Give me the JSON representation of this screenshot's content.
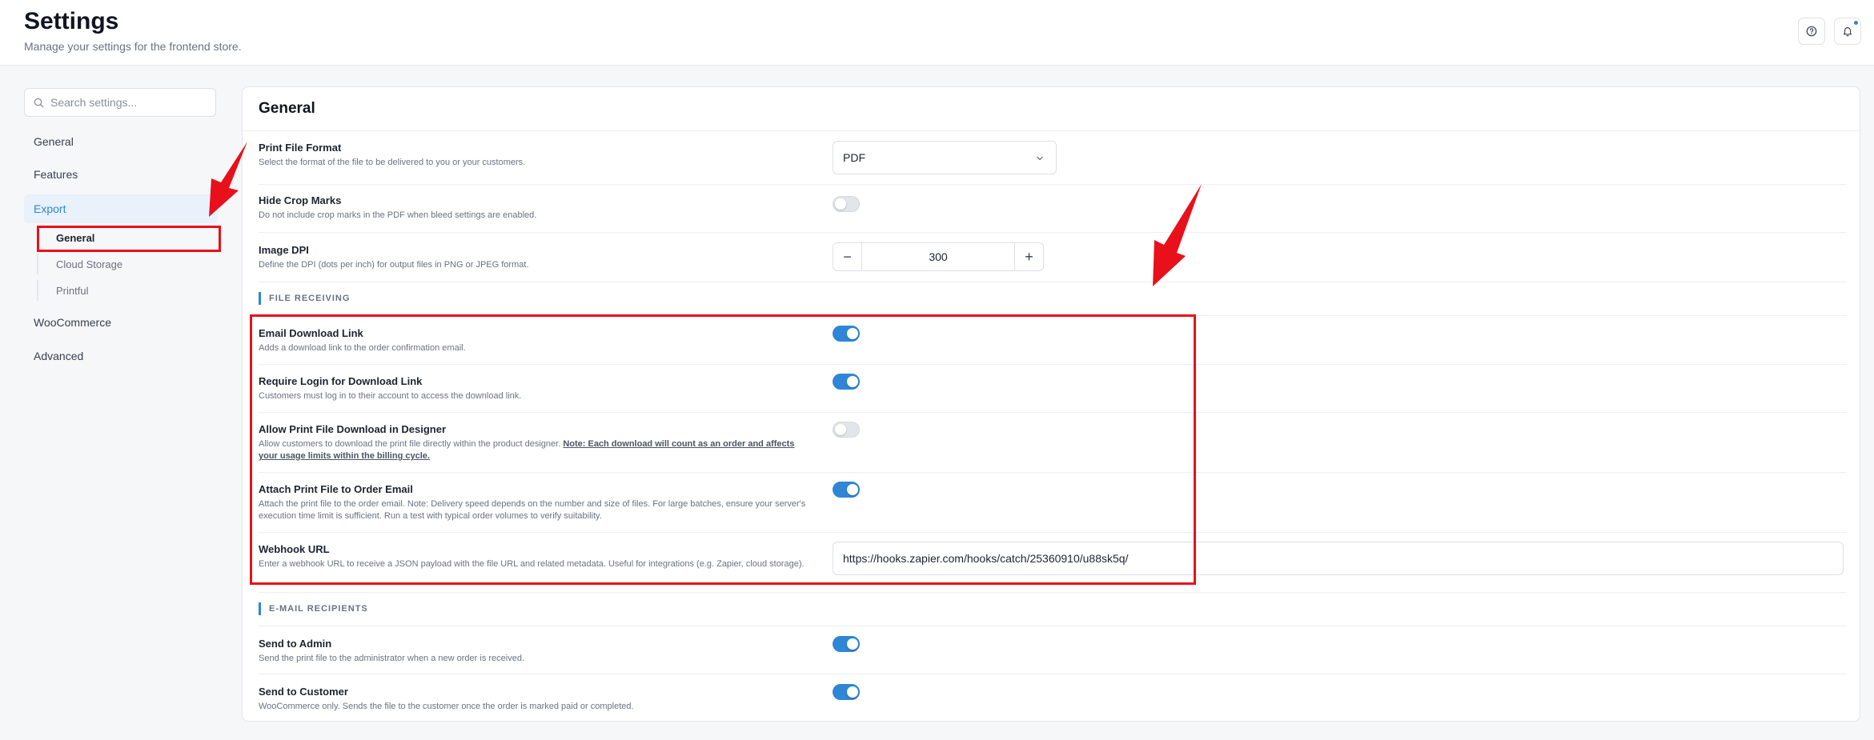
{
  "header": {
    "title": "Settings",
    "subtitle": "Manage your settings for the frontend store.",
    "help_icon": "help-circle-icon",
    "bell_icon": "bell-icon"
  },
  "sidebar": {
    "search_placeholder": "Search settings...",
    "items": [
      {
        "label": "General"
      },
      {
        "label": "Features"
      },
      {
        "label": "Export",
        "active": true
      },
      {
        "label": "WooCommerce"
      },
      {
        "label": "Advanced"
      }
    ],
    "export_sub": [
      {
        "label": "General",
        "active": true
      },
      {
        "label": "Cloud Storage"
      },
      {
        "label": "Printful"
      }
    ]
  },
  "main": {
    "title": "General",
    "print_file_format": {
      "label": "Print File Format",
      "desc": "Select the format of the file to be delivered to you or your customers.",
      "value": "PDF"
    },
    "hide_crop_marks": {
      "label": "Hide Crop Marks",
      "desc": "Do not include crop marks in the PDF when bleed settings are enabled.",
      "enabled": false
    },
    "image_dpi": {
      "label": "Image DPI",
      "desc": "Define the DPI (dots per inch) for output files in PNG or JPEG format.",
      "value": "300",
      "minus": "−",
      "plus": "+"
    },
    "file_receiving": {
      "heading": "FILE RECEIVING",
      "email_download_link": {
        "label": "Email Download Link",
        "desc": "Adds a download link to the order confirmation email.",
        "enabled": true
      },
      "require_login": {
        "label": "Require Login for Download Link",
        "desc": "Customers must log in to their account to access the download link.",
        "enabled": true
      },
      "allow_designer_download": {
        "label": "Allow Print File Download in Designer",
        "desc": "Allow customers to download the print file directly within the product designer.",
        "note": "Note: Each download will count as an order and affects your usage limits within the billing cycle.",
        "enabled": false
      },
      "attach_print_file": {
        "label": "Attach Print File to Order Email",
        "desc": "Attach the print file to the order email. Note: Delivery speed depends on the number and size of files. For large batches, ensure your server's execution time limit is sufficient. Run a test with typical order volumes to verify suitability.",
        "enabled": true
      },
      "webhook_url": {
        "label": "Webhook URL",
        "desc": "Enter a webhook URL to receive a JSON payload with the file URL and related metadata. Useful for integrations (e.g. Zapier, cloud storage).",
        "value": "https://hooks.zapier.com/hooks/catch/25360910/u88sk5q/"
      }
    },
    "email_recipients": {
      "heading": "E-MAIL RECIPIENTS",
      "send_to_admin": {
        "label": "Send to Admin",
        "desc": "Send the print file to the administrator when a new order is received.",
        "enabled": true
      },
      "send_to_customer": {
        "label": "Send to Customer",
        "desc": "WooCommerce only. Sends the file to the customer once the order is marked paid or completed.",
        "enabled": true
      }
    }
  },
  "colors": {
    "accent": "#2f86d6",
    "annotation": "#e8101a"
  }
}
